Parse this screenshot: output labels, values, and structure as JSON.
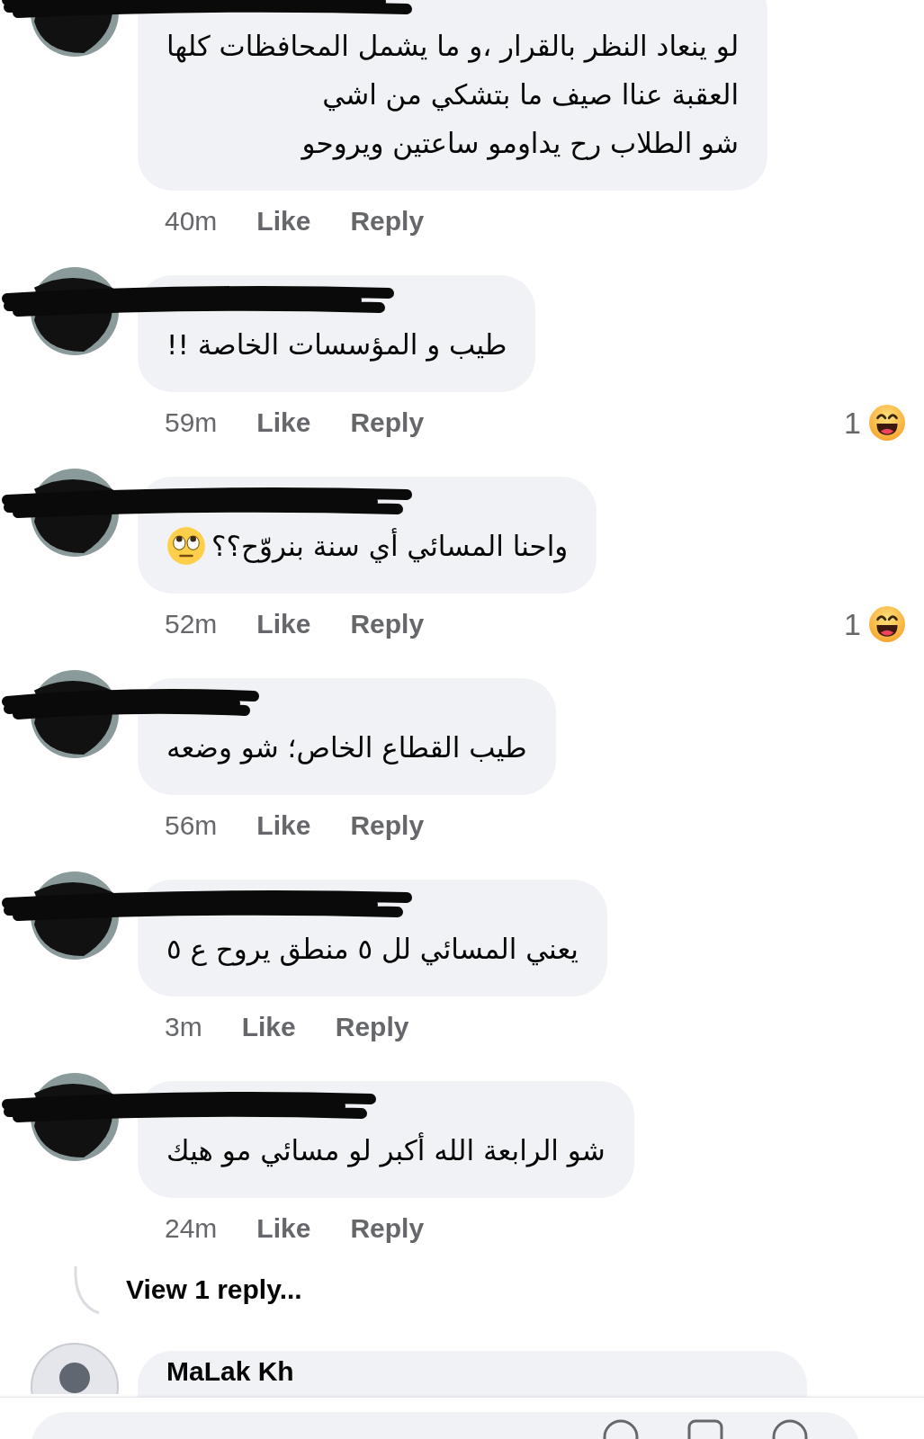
{
  "comments": [
    {
      "author": {
        "redacted": true
      },
      "lines": [
        "لو ينعاد النظر بالقرار ،و ما يشمل المحافظات كلها",
        "العقبة عناا صيف ما بتشكي من اشي",
        "شو الطلاب رح يداومو ساعتين ويروحو"
      ],
      "time": "40m",
      "like": "Like",
      "reply": "Reply"
    },
    {
      "author": {
        "redacted": true
      },
      "lines": [
        "طيب و المؤسسات الخاصة !!"
      ],
      "time": "59m",
      "like": "Like",
      "reply": "Reply",
      "reaction": {
        "count": "1",
        "kind": "haha"
      }
    },
    {
      "author": {
        "redacted": true
      },
      "lines": [
        "واحنا المسائي أي سنة بنروّح؟؟"
      ],
      "eyeroll_emoji": true,
      "time": "52m",
      "like": "Like",
      "reply": "Reply",
      "reaction": {
        "count": "1",
        "kind": "haha"
      }
    },
    {
      "author": {
        "redacted": true
      },
      "lines": [
        "طيب القطاع الخاص؛ شو وضعه"
      ],
      "time": "56m",
      "like": "Like",
      "reply": "Reply"
    },
    {
      "author": {
        "redacted": true
      },
      "lines": [
        "يعني المسائي لل ٥ منطق يروح ع ٥"
      ],
      "time": "3m",
      "like": "Like",
      "reply": "Reply"
    },
    {
      "author": {
        "redacted": true
      },
      "lines": [
        "شو الرابعة الله أكبر لو مسائي مو هيك"
      ],
      "time": "24m",
      "like": "Like",
      "reply": "Reply",
      "replies_link": "View 1 reply..."
    },
    {
      "author": {
        "redacted": false,
        "name": "MaLak Kh"
      }
    }
  ]
}
